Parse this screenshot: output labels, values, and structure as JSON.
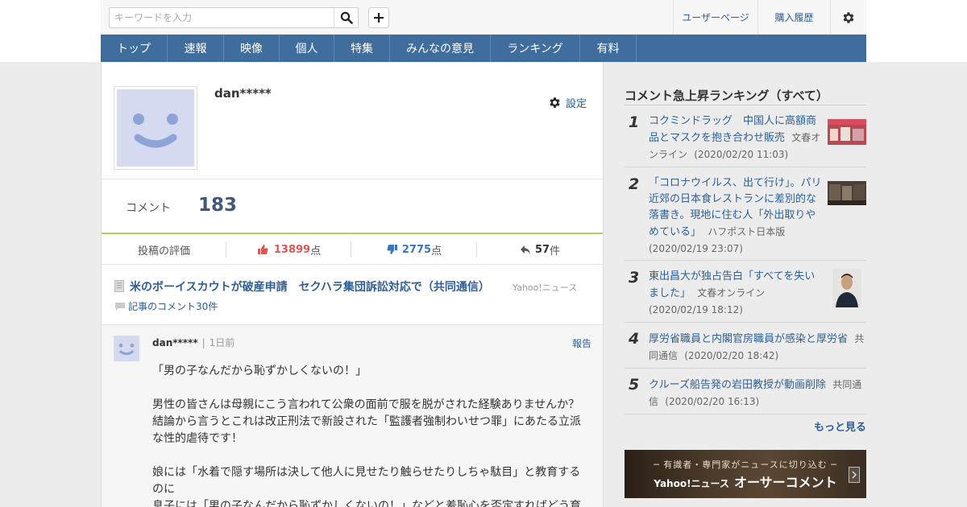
{
  "search": {
    "placeholder": "キーワードを入力"
  },
  "header_links": {
    "user_page": "ユーザーページ",
    "purchase_history": "購入履歴"
  },
  "nav": [
    {
      "label": "トップ"
    },
    {
      "label": "速報"
    },
    {
      "label": "映像"
    },
    {
      "label": "個人"
    },
    {
      "label": "特集"
    },
    {
      "label": "みんなの意見"
    },
    {
      "label": "ランキング"
    },
    {
      "label": "有料"
    }
  ],
  "profile": {
    "username": "dan*****",
    "settings_label": "設定",
    "comment_label": "コメント",
    "comment_count": "183",
    "stats": {
      "label": "投稿の評価",
      "likes": "13899",
      "likes_unit": "点",
      "dislikes": "2775",
      "dislikes_unit": "点",
      "replies": "57",
      "replies_unit": "件"
    }
  },
  "article": {
    "title": "米のボーイスカウトが破産申請　セクハラ集団訴訟対応で（共同通信）",
    "source": "Yahoo!ニュース",
    "comment_link": "記事のコメント30件"
  },
  "comment": {
    "user": "dan*****",
    "time": "1日前",
    "report": "報告",
    "paragraphs": [
      "「男の子なんだから恥ずかしくないの！」",
      "男性の皆さんは母親にこう言われて公衆の面前で服を脱がされた経験ありませんか？\n結論から言うとこれは改正刑法で新設された「監護者強制わいせつ罪」にあたる立派な性的虐待です！",
      "娘には「水着で隠す場所は決して他人に見せたり触らせたりしちゃ駄目」と教育するのに\n息子には「男の子なんだから恥ずかしくないの！」などと羞恥心を否定すればどう育"
    ]
  },
  "sidebar": {
    "title": "コメント急上昇ランキング（すべて）",
    "items": [
      {
        "rank": "1",
        "title": "コクミンドラッグ　中国人に高額商品とマスクを抱き合わせ販売",
        "source": "文春オンライン",
        "date": "(2020/02/20 11:03)"
      },
      {
        "rank": "2",
        "title": "「コロナウイルス、出て行け」。パリ近郊の日本食レストランに差別的な落書き。現地に住む人「外出取りやめている」",
        "source": "ハフポスト日本版",
        "date": "(2020/02/19 23:07)"
      },
      {
        "rank": "3",
        "title": "東出昌大が独占告白「すべてを失いました」",
        "source": "文春オンライン",
        "date": "(2020/02/19 18:12)"
      },
      {
        "rank": "4",
        "title": "厚労省職員と内閣官房職員が感染と厚労省",
        "source": "共同通信",
        "date": "(2020/02/20 18:42)"
      },
      {
        "rank": "5",
        "title": "クルーズ船告発の岩田教授が動画削除",
        "source": "共同通信",
        "date": "(2020/02/20 16:13)"
      }
    ],
    "more": "もっと見る",
    "banner": {
      "sub": "─ 有識者・専門家がニュースに切り込む ─",
      "brand": "Yahoo!ニュース",
      "title": "オーサーコメント"
    }
  },
  "colors": {
    "nav_bg": "#3f6e9e",
    "link": "#2d5f96",
    "good": "#e05555",
    "bad": "#3a76b8",
    "accent_line": "#b5cf5d"
  }
}
